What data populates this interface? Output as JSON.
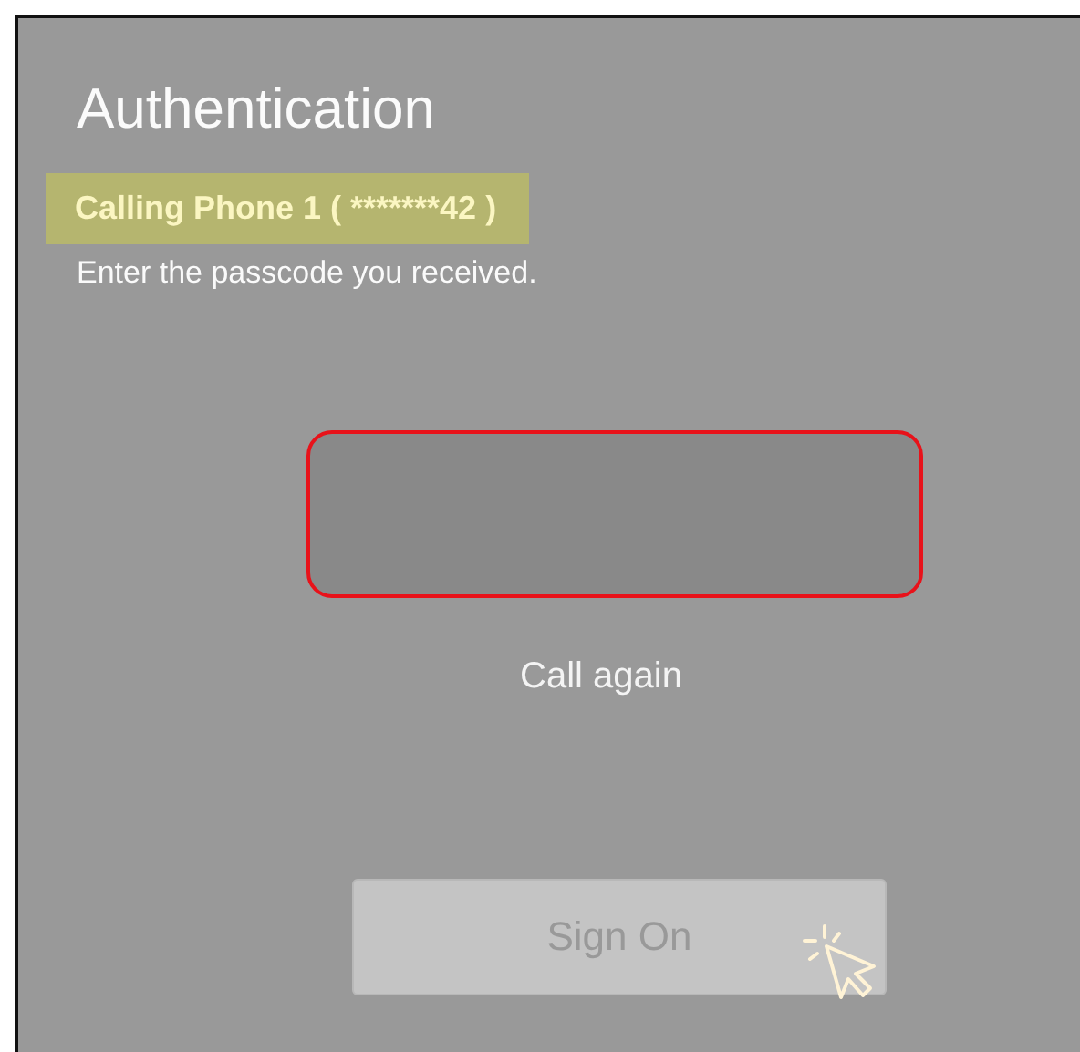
{
  "title": "Authentication",
  "calling": {
    "text": "Calling Phone 1 ( *******42 )",
    "highlighted": true
  },
  "instruction": "Enter the passcode you received.",
  "passcode_field": {
    "error": true
  },
  "call_again": "Call again",
  "sign_on": {
    "label": "Sign On",
    "disabled": true
  }
}
